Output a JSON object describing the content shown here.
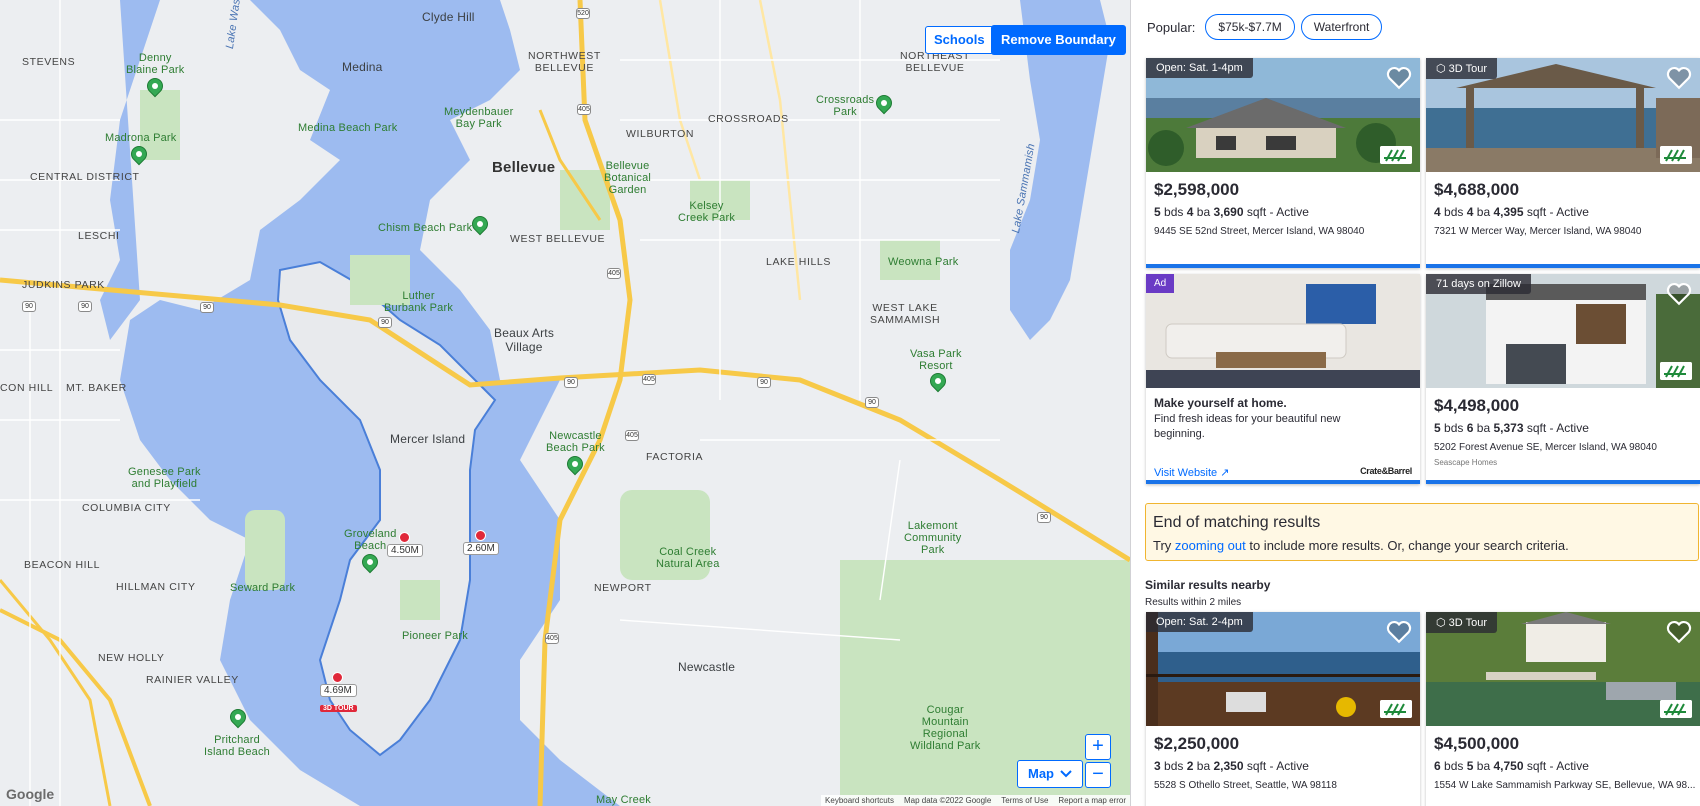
{
  "map": {
    "schools_label": "Schools",
    "remove_boundary_label": "Remove Boundary",
    "map_type_label": "Map",
    "zoom_in": "+",
    "zoom_out": "−",
    "google_logo": "Google",
    "footer": [
      "Keyboard shortcuts",
      "Map data ©2022 Google",
      "Terms of Use",
      "Report a map error"
    ],
    "labels": {
      "bellevue": "Bellevue",
      "mercer_island": "Mercer Island",
      "medina": "Medina",
      "clyde_hill": "Clyde Hill",
      "beaux_arts": "Beaux Arts\nVillage",
      "newcastle": "Newcastle",
      "factoria": "FACTORIA",
      "newport": "NEWPORT",
      "lake_hills": "LAKE HILLS",
      "crossroads": "CROSSROADS",
      "wilburton": "WILBURTON",
      "west_bellevue": "WEST BELLEVUE",
      "northwest_bellevue": "NORTHWEST\nBELLEVUE",
      "northeast_bellevue": "NORTHEAST\nBELLEVUE",
      "west_lake_sammamish": "WEST LAKE\nSAMMAMISH",
      "stevens": "STEVENS",
      "central_district": "CENTRAL DISTRICT",
      "leschi": "LESCHI",
      "judkins_park": "JUDKINS PARK",
      "mt_baker": "MT. BAKER",
      "con_hill": "CON HILL",
      "columbia_city": "COLUMBIA CITY",
      "beacon_hill": "BEACON HILL",
      "hillman_city": "HILLMAN CITY",
      "new_holly": "NEW HOLLY",
      "rainier_valley": "RAINIER VALLEY",
      "lake_washington": "Lake Washington",
      "lake_sammamish": "Lake Sammamish",
      "denny_blaine": "Denny\nBlaine Park",
      "madrona": "Madrona Park",
      "medina_beach": "Medina Beach Park",
      "meydenbauer": "Meydenbauer\nBay Park",
      "chism": "Chism Beach Park",
      "bellevue_botanical": "Bellevue\nBotanical\nGarden",
      "kelsey": "Kelsey\nCreek Park",
      "crossroads_park": "Crossroads\nPark",
      "weowna": "Weowna Park",
      "vasa": "Vasa Park\nResort",
      "luther": "Luther\nBurbank Park",
      "genesee": "Genesee Park\nand Playfield",
      "newcastle_beach": "Newcastle\nBeach Park",
      "groveland": "Groveland\nBeach",
      "seward": "Seward Park",
      "pioneer": "Pioneer Park",
      "coal_creek": "Coal Creek\nNatural Area",
      "lakemont": "Lakemont\nCommunity\nPark",
      "pritchard": "Pritchard\nIsland Beach",
      "cougar": "Cougar\nMountain\nRegional\nWildland Park",
      "may_creek": "May Creek"
    },
    "price_pins": [
      {
        "label": "4.50M",
        "tour": ""
      },
      {
        "label": "2.60M",
        "tour": ""
      },
      {
        "label": "4.69M",
        "tour": "3D TOUR"
      }
    ]
  },
  "popular": {
    "label": "Popular:",
    "chips": [
      "$75k-$7.7M",
      "Waterfront"
    ]
  },
  "listings": [
    {
      "badge": "Open: Sat. 1-4pm",
      "price": "$2,598,000",
      "bds": "5",
      "ba": "4",
      "sqft": "3,690",
      "status": "Active",
      "address": "9445 SE 52nd Street, Mercer Island, WA 98040",
      "agent": "",
      "photo": "house-modern"
    },
    {
      "badge": "3D Tour",
      "price": "$4,688,000",
      "bds": "4",
      "ba": "4",
      "sqft": "4,395",
      "status": "Active",
      "address": "7321 W Mercer Way, Mercer Island, WA 98040",
      "agent": "",
      "photo": "gazebo"
    },
    {
      "badge": "71 days on Zillow",
      "price": "$4,498,000",
      "bds": "5",
      "ba": "6",
      "sqft": "5,373",
      "status": "Active",
      "address": "5202 Forest Avenue SE, Mercer Island, WA 98040",
      "agent": "Seascape Homes",
      "photo": "modern-white"
    },
    {
      "badge": "Open: Sat. 2-4pm",
      "price": "$2,250,000",
      "bds": "3",
      "ba": "2",
      "sqft": "2,350",
      "status": "Active",
      "address": "5528 S Othello Street, Seattle, WA 98118",
      "agent": "",
      "photo": "deck-view"
    },
    {
      "badge": "3D Tour",
      "price": "$4,500,000",
      "bds": "6",
      "ba": "5",
      "sqft": "4,750",
      "status": "Active",
      "address": "1554 W Lake Sammamish Parkway SE, Bellevue, WA 98...",
      "agent": "",
      "photo": "lake-house"
    }
  ],
  "ad": {
    "badge": "Ad",
    "title": "Make yourself at home.",
    "text": "Find fresh ideas for your beautiful new beginning.",
    "link": "Visit Website",
    "sponsor": "Crate&Barrel"
  },
  "end_results": {
    "title": "End of matching results",
    "pre": "Try ",
    "link": "zooming out",
    "post": " to include more results. Or, change your search criteria."
  },
  "similar": {
    "title": "Similar results nearby",
    "subtitle": "Results within 2 miles"
  },
  "units": {
    "bds": "bds",
    "ba": "ba",
    "sqft": "sqft"
  },
  "colors": {
    "accent": "#006aff",
    "pin": "#e0283a",
    "water": "#9dbbf0",
    "park": "#b8dcb0",
    "highway": "#f7c948"
  }
}
